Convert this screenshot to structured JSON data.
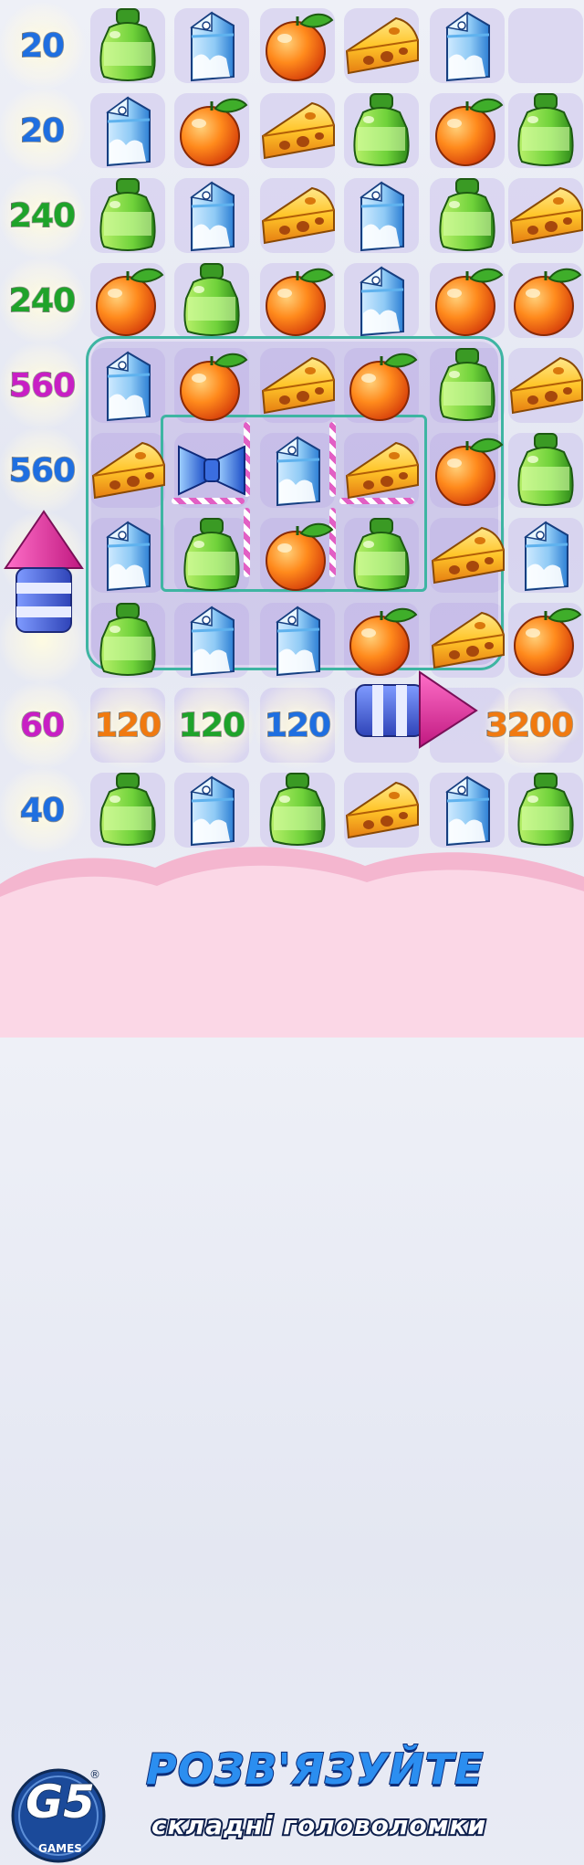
{
  "game": {
    "grid": [
      [
        "bottle",
        "milk",
        "orange",
        "cheese",
        "milk"
      ],
      [
        "milk",
        "orange",
        "cheese",
        "bottle",
        "orange",
        "bottle"
      ],
      [
        "bottle",
        "milk",
        "cheese",
        "milk",
        "bottle",
        "cheese"
      ],
      [
        "orange",
        "bottle",
        "orange",
        "milk",
        "orange",
        "orange"
      ],
      [
        "milk",
        "orange",
        "cheese",
        "orange",
        "bottle",
        "cheese"
      ],
      [
        "cheese",
        "candy",
        "milk",
        "cheese",
        "orange",
        "bottle"
      ],
      [
        "milk",
        "bottle",
        "orange",
        "bottle",
        "cheese",
        "milk"
      ],
      [
        "bottle",
        "milk",
        "milk",
        "orange",
        "cheese",
        "orange"
      ],
      [
        "",
        "",
        "",
        "",
        "",
        ""
      ],
      [
        "bottle",
        "milk",
        "bottle",
        "cheese",
        "milk",
        "bottle"
      ]
    ],
    "row_scores": [
      "20",
      "20",
      "240",
      "240",
      "560",
      "560",
      "",
      "",
      "60",
      "40"
    ],
    "row_score_colors": [
      "#1f6fe0",
      "#1f6fe0",
      "#1fa32a",
      "#1fa32a",
      "#c81fc4",
      "#1f6fe0",
      "",
      "",
      "#c81fc4",
      "#1f6fe0"
    ],
    "combo_scores": [
      {
        "text": "120",
        "color": "#f07a10"
      },
      {
        "text": "120",
        "color": "#1fa32a"
      },
      {
        "text": "120",
        "color": "#1f6fe0"
      },
      {
        "text": "3200",
        "color": "#f07a10"
      }
    ],
    "colors": {
      "orange": "#ff8a1c",
      "bottle": "#6fd23a",
      "milk": "#5fb2ee",
      "cheese": "#ffc529",
      "frame": "#3eb5a2",
      "rocket_pink": "#f0369f",
      "rocket_stripe": "#4e6fe0"
    }
  },
  "banner": {
    "headline": "РОЗВ'ЯЗУЙТЕ",
    "subline": "складні головоломки",
    "logo_mark": "G5",
    "logo_text": "GAMES",
    "logo_reg": "®",
    "cloud_color": "#f4b6cf"
  }
}
